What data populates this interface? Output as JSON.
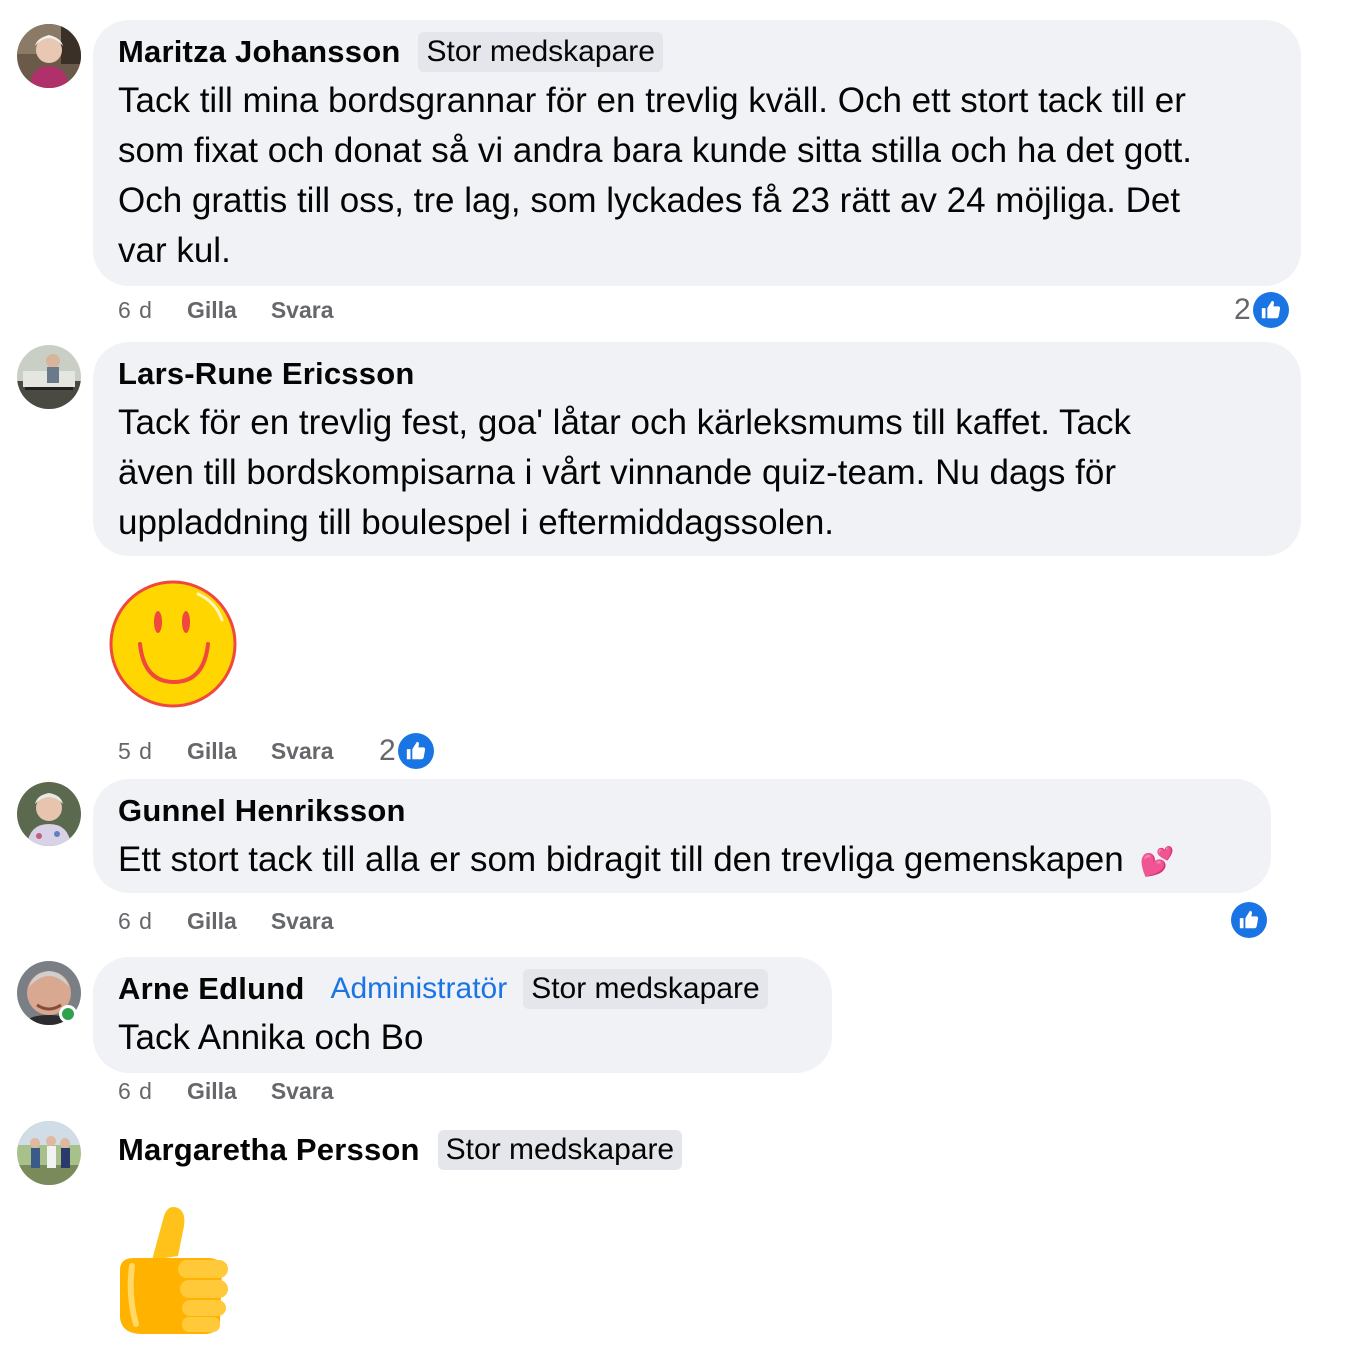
{
  "comments": [
    {
      "author": "Maritza Johansson",
      "badge": "Stor medskapare",
      "lines": [
        "Tack till mina bordsgrannar för en trevlig kväll. Och ett stort tack till er",
        "som fixat och donat så vi andra bara kunde sitta stilla och ha det gott.",
        "Och grattis till oss, tre lag, som lyckades få 23 rätt av 24 möjliga. Det",
        "var kul."
      ],
      "time": "6 d",
      "like_label": "Gilla",
      "reply_label": "Svara",
      "reaction_count": "2"
    },
    {
      "author": "Lars-Rune Ericsson",
      "lines": [
        "Tack för en trevlig fest, goa' låtar och kärleksmums till kaffet. Tack",
        "även till bordskompisarna i vårt vinnande quiz-team. Nu dags för",
        "uppladdning till boulespel i eftermiddagssolen."
      ],
      "sticker": "smiley-face-sticker",
      "time": "5 d",
      "like_label": "Gilla",
      "reply_label": "Svara",
      "reaction_count": "2"
    },
    {
      "author": "Gunnel Henriksson",
      "text": "Ett stort tack till alla er som bidragit till den trevliga gemenskapen",
      "emoji": "💕",
      "time": "6 d",
      "like_label": "Gilla",
      "reply_label": "Svara"
    },
    {
      "author": "Arne Edlund",
      "role": "Administratör",
      "badge": "Stor medskapare",
      "text": "Tack Annika och Bo",
      "online": true,
      "time": "6 d",
      "like_label": "Gilla",
      "reply_label": "Svara"
    },
    {
      "author": "Margaretha Persson",
      "badge": "Stor medskapare",
      "sticker": "thumbs-up-sticker"
    }
  ],
  "colors": {
    "bubble": "#f0f2f5",
    "badge": "#e4e6eb",
    "admin": "#1b74e4",
    "like": "#1b74e4",
    "meta": "#65676b",
    "online": "#31a24c"
  }
}
